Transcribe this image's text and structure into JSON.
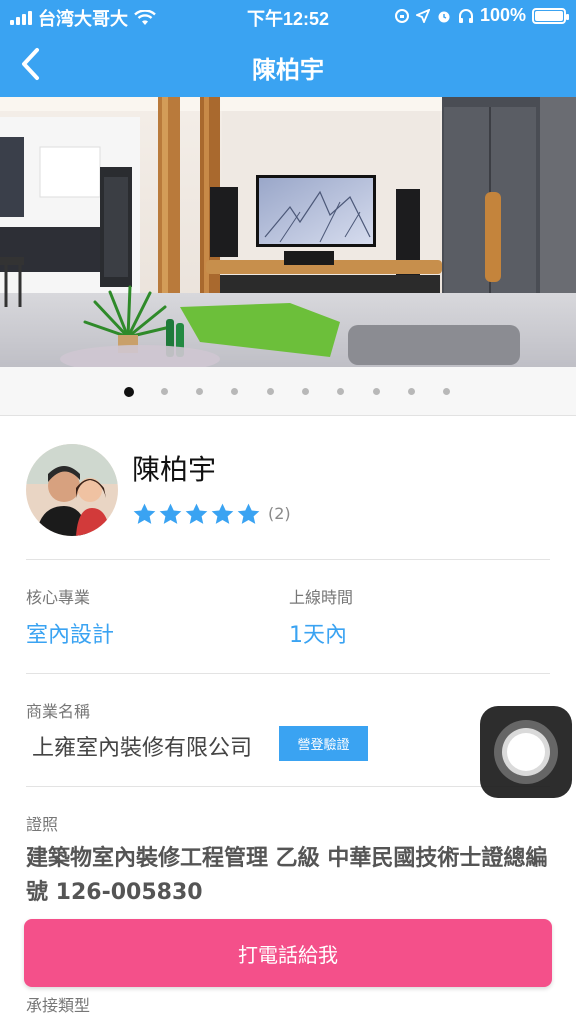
{
  "status_bar": {
    "carrier": "台湾大哥大",
    "time": "下午12:52",
    "battery": "100%",
    "battery_level": 1.0
  },
  "nav": {
    "title": "陳柏宇",
    "back_icon": "chevron-left-icon"
  },
  "gallery": {
    "image_count": 10,
    "active_index": 0
  },
  "profile": {
    "name": "陳柏宇",
    "rating": 5,
    "rating_count": "(2)"
  },
  "info": {
    "specialty_label": "核心專業",
    "specialty_value": "室內設計",
    "online_label": "上線時間",
    "online_value": "1天內"
  },
  "business": {
    "label": "商業名稱",
    "company": "上雍室內裝修有限公司",
    "verify_badge": "營登驗證"
  },
  "license": {
    "label": "證照",
    "text": "建築物室內裝修工程管理 乙級 中華民國技術士證總編號 126-005830"
  },
  "actions": {
    "call_label": "打電話給我"
  },
  "next_section": {
    "label": "承接類型"
  },
  "colors": {
    "accent": "#3aa3f2",
    "call_button": "#f4508a",
    "star": "#3aa3f2"
  }
}
